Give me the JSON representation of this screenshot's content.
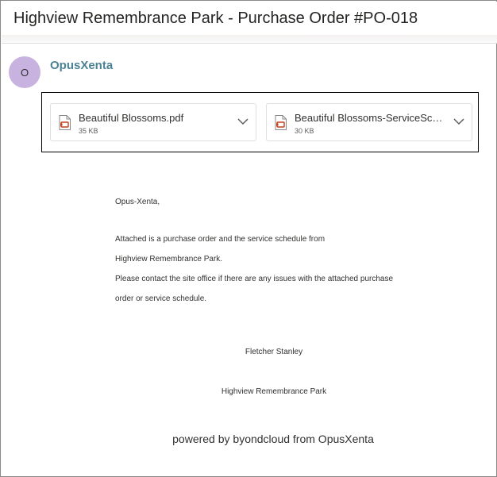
{
  "email": {
    "subject": "Highview Remembrance Park - Purchase Order #PO-018",
    "sender_initial": "O",
    "sender_name": "OpusXenta"
  },
  "attachments": [
    {
      "name": "Beautiful Blossoms.pdf",
      "size": "35 KB",
      "icon": "pdf-file-icon"
    },
    {
      "name": "Beautiful Blossoms-ServiceSchedule.pdf",
      "size": "30 KB",
      "icon": "pdf-file-icon"
    }
  ],
  "body": {
    "greeting": "Opus-Xenta,",
    "lines": [
      "Attached is a purchase order and the service schedule from",
      "Highview Remembrance Park.",
      "Please contact the site office if there are any issues with the attached purchase",
      "order or service schedule."
    ],
    "signature_name": "Fletcher Stanley",
    "signature_org": "Highview Remembrance Park",
    "footer": "powered by byondcloud from OpusXenta"
  },
  "colors": {
    "accent": "#4a8296",
    "avatar_bg": "#c8b3e0",
    "pdf_red": "#c43e1c"
  }
}
